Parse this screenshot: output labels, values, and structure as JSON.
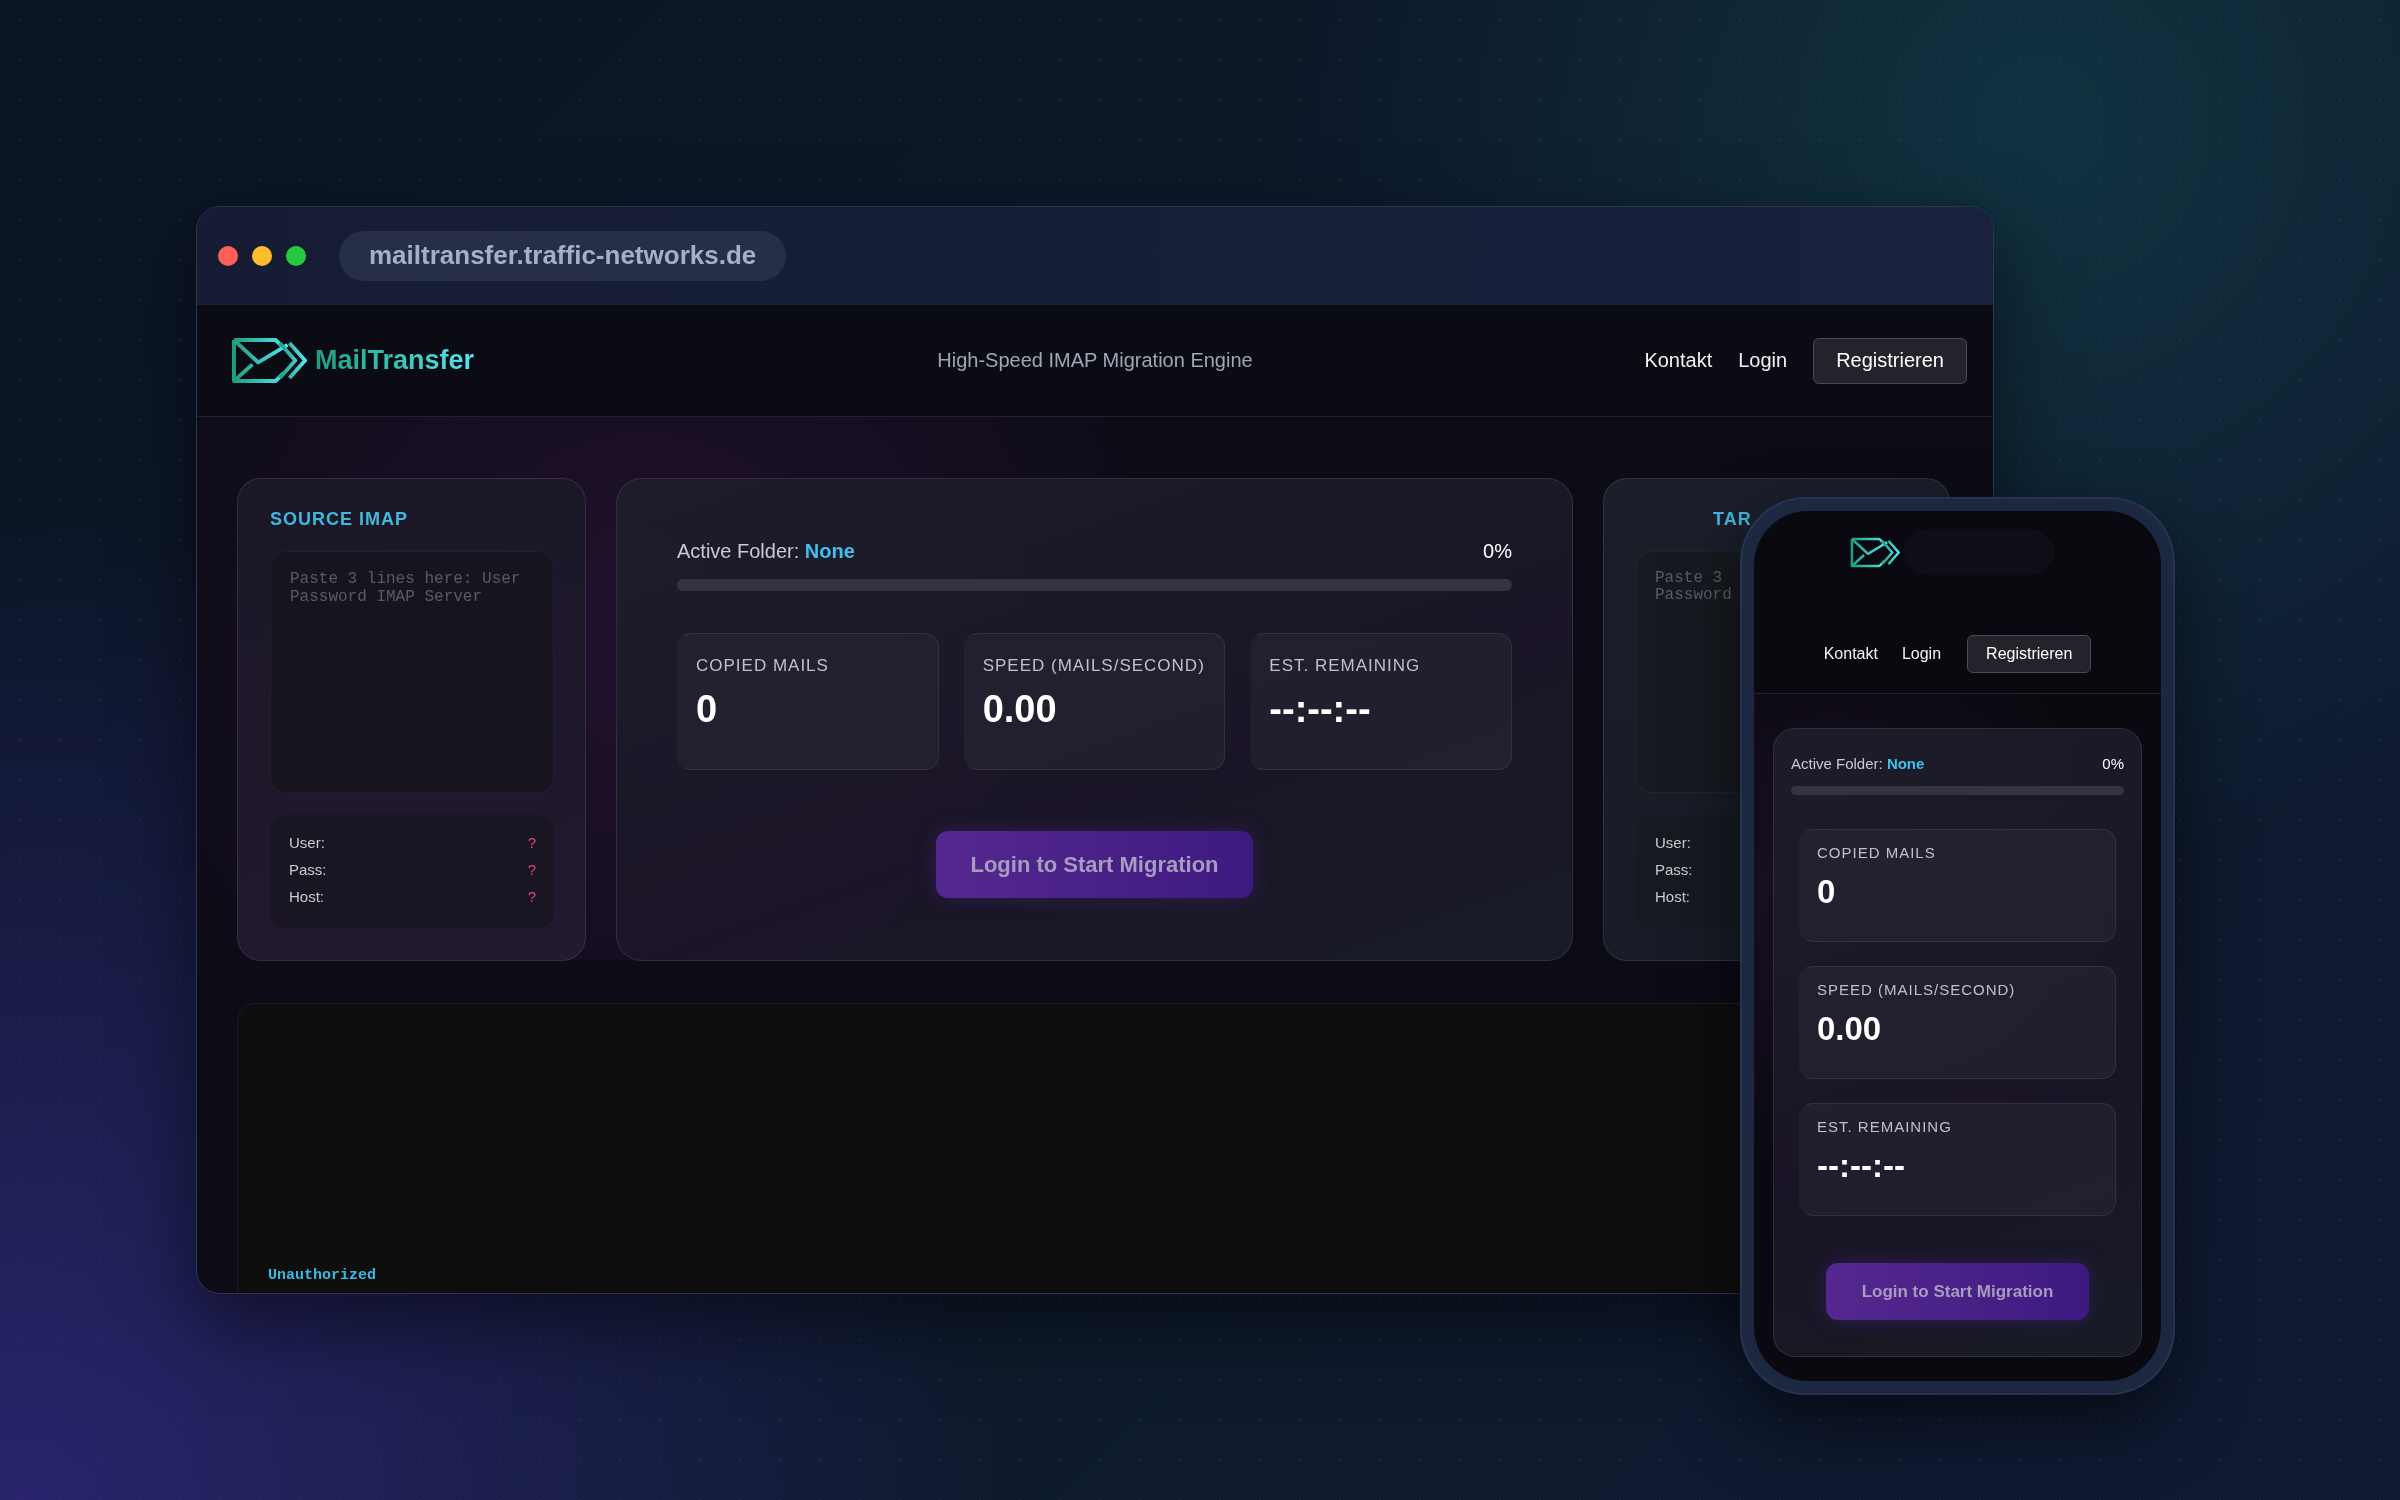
{
  "browser": {
    "url": "mailtransfer.traffic-networks.de"
  },
  "site": {
    "logo": "MailTransfer",
    "tagline": "High-Speed IMAP Migration Engine",
    "nav": [
      {
        "label": "Kontakt",
        "kind": "link"
      },
      {
        "label": "Login",
        "kind": "link"
      },
      {
        "label": "Registrieren",
        "kind": "button"
      }
    ]
  },
  "source": {
    "title": "SOURCE IMAP",
    "placeholder": "Paste 3 lines here: User Password IMAP Server",
    "fields": [
      {
        "label": "User:",
        "value": "?"
      },
      {
        "label": "Pass:",
        "value": "?"
      },
      {
        "label": "Host:",
        "value": "?"
      }
    ]
  },
  "migration": {
    "label": "Active Folder:",
    "folder": "None",
    "percent": "0%",
    "level": 0,
    "stats": [
      {
        "label": "COPIED MAILS",
        "value": "0"
      },
      {
        "label": "SPEED (MAILS/SECOND)",
        "value": "0.00"
      },
      {
        "label": "EST. REMAINING",
        "value": "--:--:--"
      }
    ],
    "button": "Login to Start Migration"
  },
  "target": {
    "title": "TAR",
    "placeholder_lines": [
      "Paste 3",
      "Password"
    ],
    "fields": [
      "User:",
      "Pass:",
      "Host:"
    ]
  },
  "console": {
    "status": "Unauthorized"
  },
  "phone": {
    "nav": [
      {
        "label": "Kontakt",
        "kind": "link"
      },
      {
        "label": "Login",
        "kind": "link"
      },
      {
        "label": "Registrieren",
        "kind": "button"
      }
    ],
    "migration": {
      "label": "Active Folder:",
      "folder": "None",
      "percent": "0%",
      "level": 0,
      "stats": [
        {
          "label": "COPIED MAILS",
          "value": "0"
        },
        {
          "label": "SPEED (MAILS/SECOND)",
          "value": "0.00"
        },
        {
          "label": "EST. REMAINING",
          "value": "--:--:--"
        }
      ],
      "button": "Login to Start Migration"
    }
  }
}
